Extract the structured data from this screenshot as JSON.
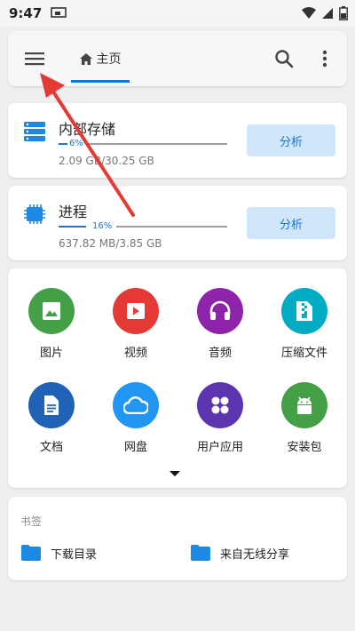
{
  "status_bar": {
    "time": "9:47",
    "icons": [
      "cast-icon",
      "wifi-icon",
      "signal-icon",
      "battery-icon"
    ]
  },
  "appbar": {
    "menu_icon": "menu-icon",
    "home_icon": "home-icon",
    "home_label": "主页",
    "search_icon": "search-icon",
    "more_icon": "more-vert-icon"
  },
  "storage": {
    "title": "内部存储",
    "percent_label": "6%",
    "percent": 6,
    "usage": "2.09 GB/30.25 GB",
    "button": "分析",
    "icon": "storage-icon"
  },
  "process": {
    "title": "进程",
    "percent_label": "16%",
    "percent": 16,
    "usage": "637.82 MB/3.85 GB",
    "button": "分析",
    "icon": "chip-icon"
  },
  "categories": [
    {
      "label": "图片",
      "icon": "image-icon",
      "color": "#43a047"
    },
    {
      "label": "视频",
      "icon": "video-icon",
      "color": "#e53935"
    },
    {
      "label": "音频",
      "icon": "headphones-icon",
      "color": "#8e24aa"
    },
    {
      "label": "压缩文件",
      "icon": "archive-icon",
      "color": "#00acc1"
    },
    {
      "label": "文档",
      "icon": "document-icon",
      "color": "#1e63b6"
    },
    {
      "label": "网盘",
      "icon": "cloud-icon",
      "color": "#2196f3"
    },
    {
      "label": "用户应用",
      "icon": "apps-icon",
      "color": "#5e35b1"
    },
    {
      "label": "安装包",
      "icon": "android-icon",
      "color": "#43a047"
    }
  ],
  "bookmarks": {
    "title": "书签",
    "items": [
      {
        "label": "下载目录",
        "icon": "folder-icon"
      },
      {
        "label": "来自无线分享",
        "icon": "folder-icon"
      }
    ]
  },
  "colors": {
    "accent": "#1976d2",
    "button_bg": "#cfe6fb",
    "annotation_arrow": "#e53935"
  }
}
